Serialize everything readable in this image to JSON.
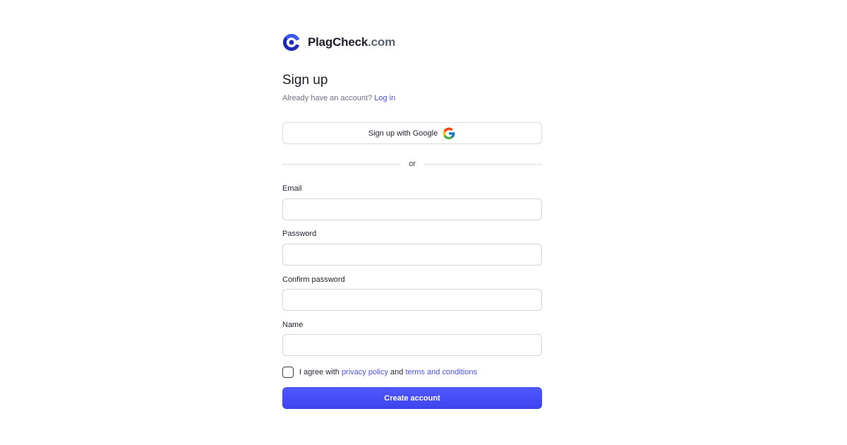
{
  "brand": {
    "name_main": "PlagCheck",
    "name_tld": ".com",
    "logo_icon": "plagcheck-logo-icon",
    "colors": {
      "logo_dark": "#1f2bb8",
      "logo_light": "#3f58f5",
      "tld": "#5b6479"
    }
  },
  "heading": {
    "title": "Sign up",
    "subtitle_prefix": "Already have an account?",
    "login_link": "Log in"
  },
  "google": {
    "label": "Sign up with Google",
    "icon": "google-g-icon"
  },
  "divider": {
    "text": "or"
  },
  "form": {
    "email": {
      "label": "Email",
      "value": "",
      "placeholder": ""
    },
    "password": {
      "label": "Password",
      "value": "",
      "placeholder": ""
    },
    "confirm_password": {
      "label": "Confirm password",
      "value": "",
      "placeholder": ""
    },
    "name": {
      "label": "Name",
      "value": "",
      "placeholder": ""
    }
  },
  "terms": {
    "prefix": "I agree with",
    "privacy_link": "privacy policy",
    "conjunction": "and",
    "terms_link": "terms and conditions",
    "checked": false
  },
  "submit": {
    "label": "Create account"
  },
  "colors": {
    "accent": "#4a4ff0",
    "button_top": "#5158ff",
    "button_bottom": "#3d43ee"
  }
}
